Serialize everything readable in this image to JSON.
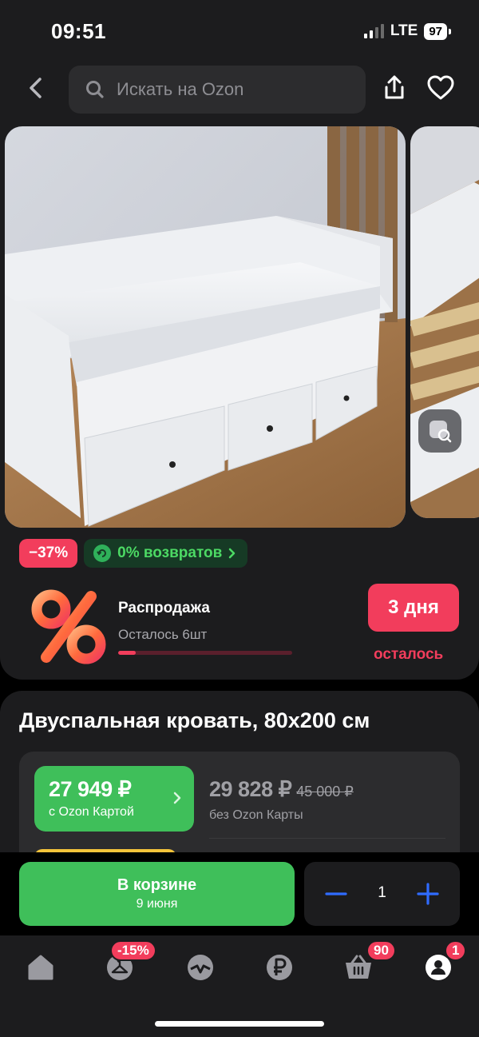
{
  "status_bar": {
    "time": "09:51",
    "network": "LTE",
    "battery": "97"
  },
  "header": {
    "search_placeholder": "Искать на Ozon"
  },
  "badges": {
    "discount": "−37%",
    "returns": "0% возвратов"
  },
  "sale": {
    "title": "Распродажа",
    "remaining": "Осталось 6шт",
    "remaining_fraction": 0.1,
    "days": "3 дня",
    "days_suffix": "осталось"
  },
  "product": {
    "title": "Двуспальная кровать, 80x200 см",
    "card_price": "27 949 ₽",
    "card_price_label": "с Ozon Картой",
    "regular_price": "29 828 ₽",
    "old_price": "45 000 ₽",
    "regular_price_label": "без Ozon Карты"
  },
  "actions": {
    "cart_label": "В корзине",
    "delivery": "9 июня",
    "quantity": "1"
  },
  "tabbar": {
    "items": [
      "home-icon",
      "fashion-icon",
      "fresh-icon",
      "finance-icon",
      "cart-icon",
      "profile-icon"
    ],
    "fashion_badge": "-15%",
    "cart_badge": "90",
    "profile_badge": "1"
  },
  "colors": {
    "accent_green": "#3fbf5a",
    "accent_red": "#f23d5c",
    "accent_blue": "#2f6bff",
    "background": "#1c1c1e"
  }
}
